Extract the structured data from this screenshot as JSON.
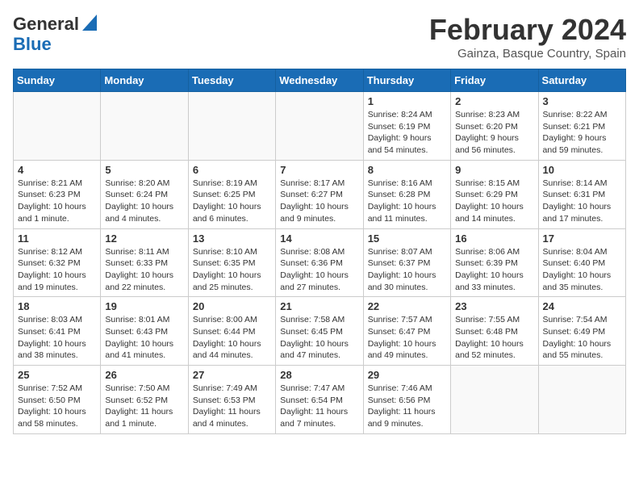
{
  "header": {
    "logo_line1": "General",
    "logo_line2": "Blue",
    "month_title": "February 2024",
    "subtitle": "Gainza, Basque Country, Spain"
  },
  "weekdays": [
    "Sunday",
    "Monday",
    "Tuesday",
    "Wednesday",
    "Thursday",
    "Friday",
    "Saturday"
  ],
  "weeks": [
    [
      {
        "day": "",
        "info": ""
      },
      {
        "day": "",
        "info": ""
      },
      {
        "day": "",
        "info": ""
      },
      {
        "day": "",
        "info": ""
      },
      {
        "day": "1",
        "info": "Sunrise: 8:24 AM\nSunset: 6:19 PM\nDaylight: 9 hours\nand 54 minutes."
      },
      {
        "day": "2",
        "info": "Sunrise: 8:23 AM\nSunset: 6:20 PM\nDaylight: 9 hours\nand 56 minutes."
      },
      {
        "day": "3",
        "info": "Sunrise: 8:22 AM\nSunset: 6:21 PM\nDaylight: 9 hours\nand 59 minutes."
      }
    ],
    [
      {
        "day": "4",
        "info": "Sunrise: 8:21 AM\nSunset: 6:23 PM\nDaylight: 10 hours\nand 1 minute."
      },
      {
        "day": "5",
        "info": "Sunrise: 8:20 AM\nSunset: 6:24 PM\nDaylight: 10 hours\nand 4 minutes."
      },
      {
        "day": "6",
        "info": "Sunrise: 8:19 AM\nSunset: 6:25 PM\nDaylight: 10 hours\nand 6 minutes."
      },
      {
        "day": "7",
        "info": "Sunrise: 8:17 AM\nSunset: 6:27 PM\nDaylight: 10 hours\nand 9 minutes."
      },
      {
        "day": "8",
        "info": "Sunrise: 8:16 AM\nSunset: 6:28 PM\nDaylight: 10 hours\nand 11 minutes."
      },
      {
        "day": "9",
        "info": "Sunrise: 8:15 AM\nSunset: 6:29 PM\nDaylight: 10 hours\nand 14 minutes."
      },
      {
        "day": "10",
        "info": "Sunrise: 8:14 AM\nSunset: 6:31 PM\nDaylight: 10 hours\nand 17 minutes."
      }
    ],
    [
      {
        "day": "11",
        "info": "Sunrise: 8:12 AM\nSunset: 6:32 PM\nDaylight: 10 hours\nand 19 minutes."
      },
      {
        "day": "12",
        "info": "Sunrise: 8:11 AM\nSunset: 6:33 PM\nDaylight: 10 hours\nand 22 minutes."
      },
      {
        "day": "13",
        "info": "Sunrise: 8:10 AM\nSunset: 6:35 PM\nDaylight: 10 hours\nand 25 minutes."
      },
      {
        "day": "14",
        "info": "Sunrise: 8:08 AM\nSunset: 6:36 PM\nDaylight: 10 hours\nand 27 minutes."
      },
      {
        "day": "15",
        "info": "Sunrise: 8:07 AM\nSunset: 6:37 PM\nDaylight: 10 hours\nand 30 minutes."
      },
      {
        "day": "16",
        "info": "Sunrise: 8:06 AM\nSunset: 6:39 PM\nDaylight: 10 hours\nand 33 minutes."
      },
      {
        "day": "17",
        "info": "Sunrise: 8:04 AM\nSunset: 6:40 PM\nDaylight: 10 hours\nand 35 minutes."
      }
    ],
    [
      {
        "day": "18",
        "info": "Sunrise: 8:03 AM\nSunset: 6:41 PM\nDaylight: 10 hours\nand 38 minutes."
      },
      {
        "day": "19",
        "info": "Sunrise: 8:01 AM\nSunset: 6:43 PM\nDaylight: 10 hours\nand 41 minutes."
      },
      {
        "day": "20",
        "info": "Sunrise: 8:00 AM\nSunset: 6:44 PM\nDaylight: 10 hours\nand 44 minutes."
      },
      {
        "day": "21",
        "info": "Sunrise: 7:58 AM\nSunset: 6:45 PM\nDaylight: 10 hours\nand 47 minutes."
      },
      {
        "day": "22",
        "info": "Sunrise: 7:57 AM\nSunset: 6:47 PM\nDaylight: 10 hours\nand 49 minutes."
      },
      {
        "day": "23",
        "info": "Sunrise: 7:55 AM\nSunset: 6:48 PM\nDaylight: 10 hours\nand 52 minutes."
      },
      {
        "day": "24",
        "info": "Sunrise: 7:54 AM\nSunset: 6:49 PM\nDaylight: 10 hours\nand 55 minutes."
      }
    ],
    [
      {
        "day": "25",
        "info": "Sunrise: 7:52 AM\nSunset: 6:50 PM\nDaylight: 10 hours\nand 58 minutes."
      },
      {
        "day": "26",
        "info": "Sunrise: 7:50 AM\nSunset: 6:52 PM\nDaylight: 11 hours\nand 1 minute."
      },
      {
        "day": "27",
        "info": "Sunrise: 7:49 AM\nSunset: 6:53 PM\nDaylight: 11 hours\nand 4 minutes."
      },
      {
        "day": "28",
        "info": "Sunrise: 7:47 AM\nSunset: 6:54 PM\nDaylight: 11 hours\nand 7 minutes."
      },
      {
        "day": "29",
        "info": "Sunrise: 7:46 AM\nSunset: 6:56 PM\nDaylight: 11 hours\nand 9 minutes."
      },
      {
        "day": "",
        "info": ""
      },
      {
        "day": "",
        "info": ""
      }
    ]
  ]
}
